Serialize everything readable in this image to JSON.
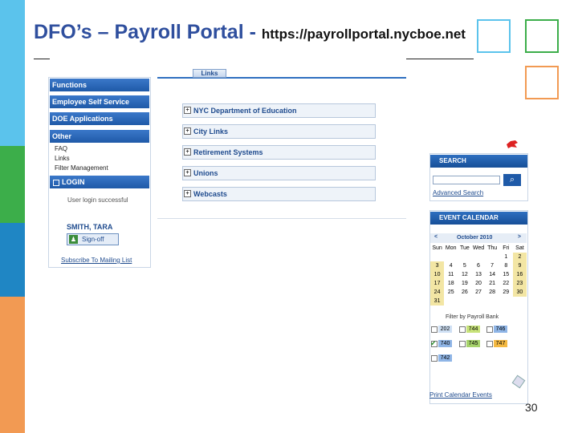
{
  "slide": {
    "title": "DFO’s – Payroll Portal -",
    "url": "https://payrollportal.nycboe.net",
    "page_number": "30",
    "band_colors": [
      "#5bc3ec",
      "#3cae4a",
      "#1f86c4",
      "#f29a53"
    ]
  },
  "sidebar": {
    "sections": [
      "Functions",
      "Employee Self Service",
      "DOE Applications",
      "Other"
    ],
    "other_items": [
      "FAQ",
      "Links",
      "Filter Management"
    ],
    "login_header": "LOGIN",
    "login_status": "User login successful",
    "user_name": "SMITH, TARA",
    "signoff_label": "Sign-off",
    "subscribe_label": "Subscribe To Mailing List"
  },
  "links": {
    "tab_label": "Links",
    "rows": [
      "NYC Department of Education",
      "City Links",
      "Retirement Systems",
      "Unions",
      "Webcasts"
    ]
  },
  "search": {
    "header": "SEARCH",
    "button": "⌕",
    "advanced_label": "Advanced Search"
  },
  "calendar": {
    "header": "EVENT CALENDAR",
    "prev": "<",
    "next": ">",
    "month": "October 2010",
    "weekdays": [
      "Sun",
      "Mon",
      "Tue",
      "Wed",
      "Thu",
      "Fri",
      "Sat"
    ],
    "weeks": [
      [
        "",
        "",
        "",
        "",
        "",
        "1",
        "2"
      ],
      [
        "3",
        "4",
        "5",
        "6",
        "7",
        "8",
        "9"
      ],
      [
        "10",
        "11",
        "12",
        "13",
        "14",
        "15",
        "16"
      ],
      [
        "17",
        "18",
        "19",
        "20",
        "21",
        "22",
        "23"
      ],
      [
        "24",
        "25",
        "26",
        "27",
        "28",
        "29",
        "30"
      ],
      [
        "31",
        "",
        "",
        "",
        "",
        "",
        ""
      ]
    ],
    "filter_label": "Filter by Payroll Bank",
    "banks": [
      "202",
      "744",
      "746",
      "740",
      "745",
      "747",
      "742"
    ],
    "bank_colors": [
      "#cfe0f4",
      "#c7e27a",
      "#8fb5e6",
      "#8fb5e6",
      "#a6d36b",
      "#f4b942",
      "#8fb5e6"
    ],
    "print_label": "Print Calendar Events"
  }
}
